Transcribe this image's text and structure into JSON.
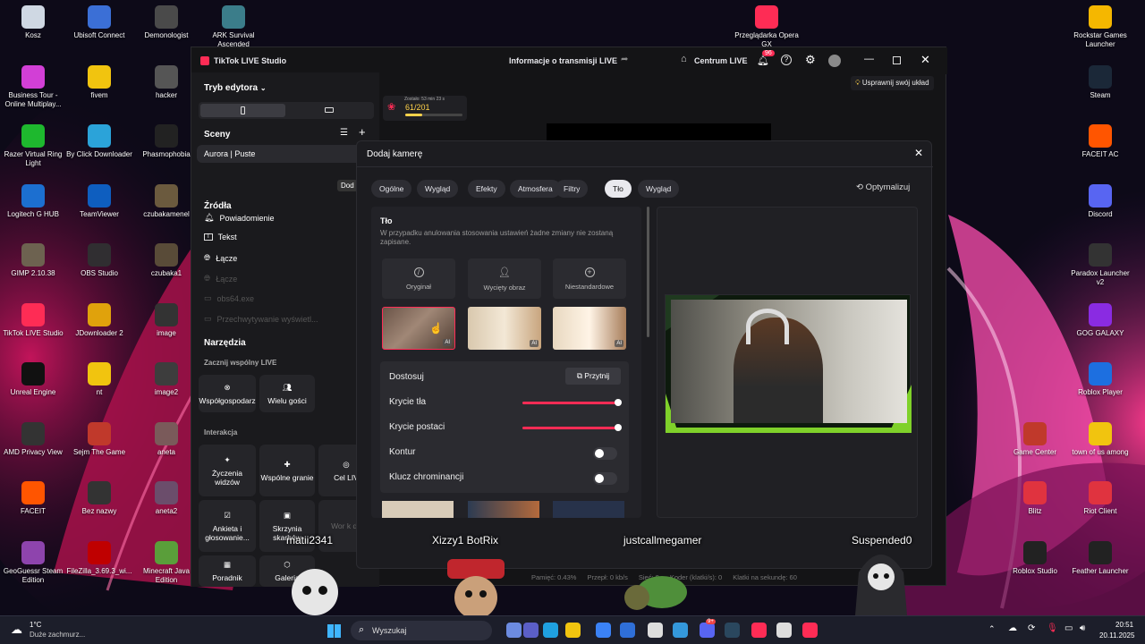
{
  "desktop": {
    "icons_left": [
      {
        "label": "Kosz",
        "icon": "recycle-bin-icon",
        "color": "#cfd8e3"
      },
      {
        "label": "Ubisoft Connect",
        "icon": "ubisoft-icon",
        "color": "#3b6fd6"
      },
      {
        "label": "Demonologist",
        "icon": "demonologist-icon",
        "color": "#4a4a4a"
      },
      {
        "label": "ARK Survival Ascended",
        "icon": "ark-icon",
        "color": "#3b7d8a"
      },
      {
        "label": "Business Tour - Online Multiplay...",
        "icon": "business-tour-icon",
        "color": "#d23fd6"
      },
      {
        "label": "fivem",
        "icon": "folder-icon",
        "color": "#f1c40f"
      },
      {
        "label": "hacker",
        "icon": "hacker-icon",
        "color": "#555"
      },
      {
        "label": "Razer Virtual Ring Light",
        "icon": "razer-icon",
        "color": "#1eb82e"
      },
      {
        "label": "By Click Downloader",
        "icon": "byclick-icon",
        "color": "#2ba3d9"
      },
      {
        "label": "Phasmophobia",
        "icon": "phasmophobia-icon",
        "color": "#222"
      },
      {
        "label": "Logitech G HUB",
        "icon": "logitech-icon",
        "color": "#1c6fd0"
      },
      {
        "label": "TeamViewer",
        "icon": "teamviewer-icon",
        "color": "#0e5ebf"
      },
      {
        "label": "czubakamenel",
        "icon": "photo-icon",
        "color": "#6b5a3e"
      },
      {
        "label": "GIMP 2.10.38",
        "icon": "gimp-icon",
        "color": "#6d6250"
      },
      {
        "label": "OBS Studio",
        "icon": "obs-icon",
        "color": "#302e31"
      },
      {
        "label": "czubaka1",
        "icon": "photo-icon",
        "color": "#594b38"
      },
      {
        "label": "TikTok LIVE Studio",
        "icon": "tiktok-icon",
        "color": "#fe2c55"
      },
      {
        "label": "JDownloader 2",
        "icon": "jdownloader-icon",
        "color": "#e0a20c"
      },
      {
        "label": "image",
        "icon": "photo-icon",
        "color": "#333"
      },
      {
        "label": "Unreal Engine",
        "icon": "unreal-icon",
        "color": "#111"
      },
      {
        "label": "nt",
        "icon": "folder-icon",
        "color": "#f1c40f"
      },
      {
        "label": "image2",
        "icon": "photo-icon",
        "color": "#3d3d3d"
      },
      {
        "label": "AMD Privacy View",
        "icon": "amd-icon",
        "color": "#333"
      },
      {
        "label": "Sejm The Game",
        "icon": "sejm-icon",
        "color": "#c0392b"
      },
      {
        "label": "aneta",
        "icon": "photo-icon",
        "color": "#7a5a5a"
      },
      {
        "label": "FACEIT",
        "icon": "faceit-icon",
        "color": "#ff5500"
      },
      {
        "label": "Bez nazwy",
        "icon": "photo-icon",
        "color": "#333"
      },
      {
        "label": "aneta2",
        "icon": "photo-icon",
        "color": "#6b4d6b"
      },
      {
        "label": "GeoGuessr Steam Edition",
        "icon": "geoguessr-icon",
        "color": "#8e44ad"
      },
      {
        "label": "FileZilla_3.69.3_wi...",
        "icon": "filezilla-icon",
        "color": "#bf0000"
      },
      {
        "label": "Minecraft Java Edition",
        "icon": "minecraft-icon",
        "color": "#5a9e3a"
      }
    ],
    "icons_right": [
      {
        "label": "Przeglądarka Opera GX",
        "icon": "opera-gx-icon",
        "color": "#fe2c55"
      },
      {
        "label": "Rockstar Games Launcher",
        "icon": "rockstar-icon",
        "color": "#f5b700"
      },
      {
        "label": "Steam",
        "icon": "steam-icon",
        "color": "#1b2838"
      },
      {
        "label": "FACEIT AC",
        "icon": "faceit-ac-icon",
        "color": "#ff5500"
      },
      {
        "label": "Discord",
        "icon": "discord-icon",
        "color": "#5865f2"
      },
      {
        "label": "Paradox Launcher v2",
        "icon": "paradox-icon",
        "color": "#333"
      },
      {
        "label": "GOG GALAXY",
        "icon": "gog-icon",
        "color": "#8a2be2"
      },
      {
        "label": "Roblox Player",
        "icon": "roblox-icon",
        "color": "#1d6fe0"
      },
      {
        "label": "Game Center",
        "icon": "game-center-icon",
        "color": "#c0392b"
      },
      {
        "label": "town of us among",
        "icon": "folder-icon",
        "color": "#f1c40f"
      },
      {
        "label": "Blitz",
        "icon": "blitz-icon",
        "color": "#e0333f"
      },
      {
        "label": "Riot Client",
        "icon": "riot-icon",
        "color": "#e0333f"
      },
      {
        "label": "Roblox Studio",
        "icon": "roblox-studio-icon",
        "color": "#222"
      },
      {
        "label": "Feather Launcher",
        "icon": "feather-icon",
        "color": "#222"
      }
    ]
  },
  "window": {
    "app_title": "TikTok LIVE Studio",
    "center_title": "Informacje o transmisji LIVE",
    "centrum": "Centrum LIVE",
    "badge": "96",
    "layout_hint": "Usprawnij swój układ"
  },
  "sidebar": {
    "mode": "Tryb edytora",
    "scenes_title": "Sceny",
    "scene": "Aurora | Puste",
    "add_tooltip": "Dod",
    "sources_title": "Źródła",
    "sources": [
      "Powiadomienie",
      "Tekst",
      "Łącze",
      "Łącze",
      "obs64.exe",
      "Przechwytywanie wyświetl..."
    ],
    "tools_title": "Narzędzia",
    "shared_title": "Zacznij wspólny LIVE",
    "cohost": "Współgospodarz",
    "multi_guest": "Wielu gości",
    "interaction_title": "Interakcja",
    "tools": [
      "Życzenia widzów",
      "Wspólne granie",
      "Cel LIV",
      "Ankieta i głosowanie...",
      "Skrzynia skarbów",
      "Wor k do",
      "Poradnik",
      "Galeria"
    ]
  },
  "goal": {
    "value": "61/201",
    "timer": "Zostało: 53 min 23 s",
    "progress": 0.3
  },
  "dialog": {
    "title": "Dodaj kamerę",
    "tabs": [
      "Ogólne",
      "Wygląd",
      "Efekty",
      "Atmosfera",
      "Filtry",
      "Tło",
      "Wygląd"
    ],
    "active_tab": "Tło",
    "optimize": "Optymalizuj",
    "section_title": "Tło",
    "section_desc": "W przypadku anulowania stosowania ustawień żadne zmiany nie zostaną zapisane.",
    "options": [
      "Oryginał",
      "Wycięty obraz",
      "Niestandardowe"
    ],
    "ai_label": "AI",
    "adjust": "Dostosuj",
    "crop": "Przytnij",
    "opacity_bg": "Krycie tła",
    "opacity_person": "Krycie postaci",
    "outline": "Kontur",
    "chroma": "Klucz chrominancji",
    "opacity_bg_value": 1.0,
    "opacity_person_value": 1.0
  },
  "status": {
    "memory": "Pamięć: 0.43%",
    "bitrate": "Przepł: 0 kb/s",
    "network": "Sieć: 0",
    "encoder": "Koder (klatki/s): 0",
    "fps": "Klatki na sekundę: 60"
  },
  "overlay_names": [
    "matii2341",
    "Xizzy1 BotRix",
    "justcallmegamer",
    "Suspended0"
  ],
  "taskbar": {
    "weather_temp": "1°C",
    "weather_text": "Duże zachmurz...",
    "search": "Wyszukaj",
    "time": "20:51",
    "date": "20.11.2025",
    "steam_badge": "9+"
  }
}
